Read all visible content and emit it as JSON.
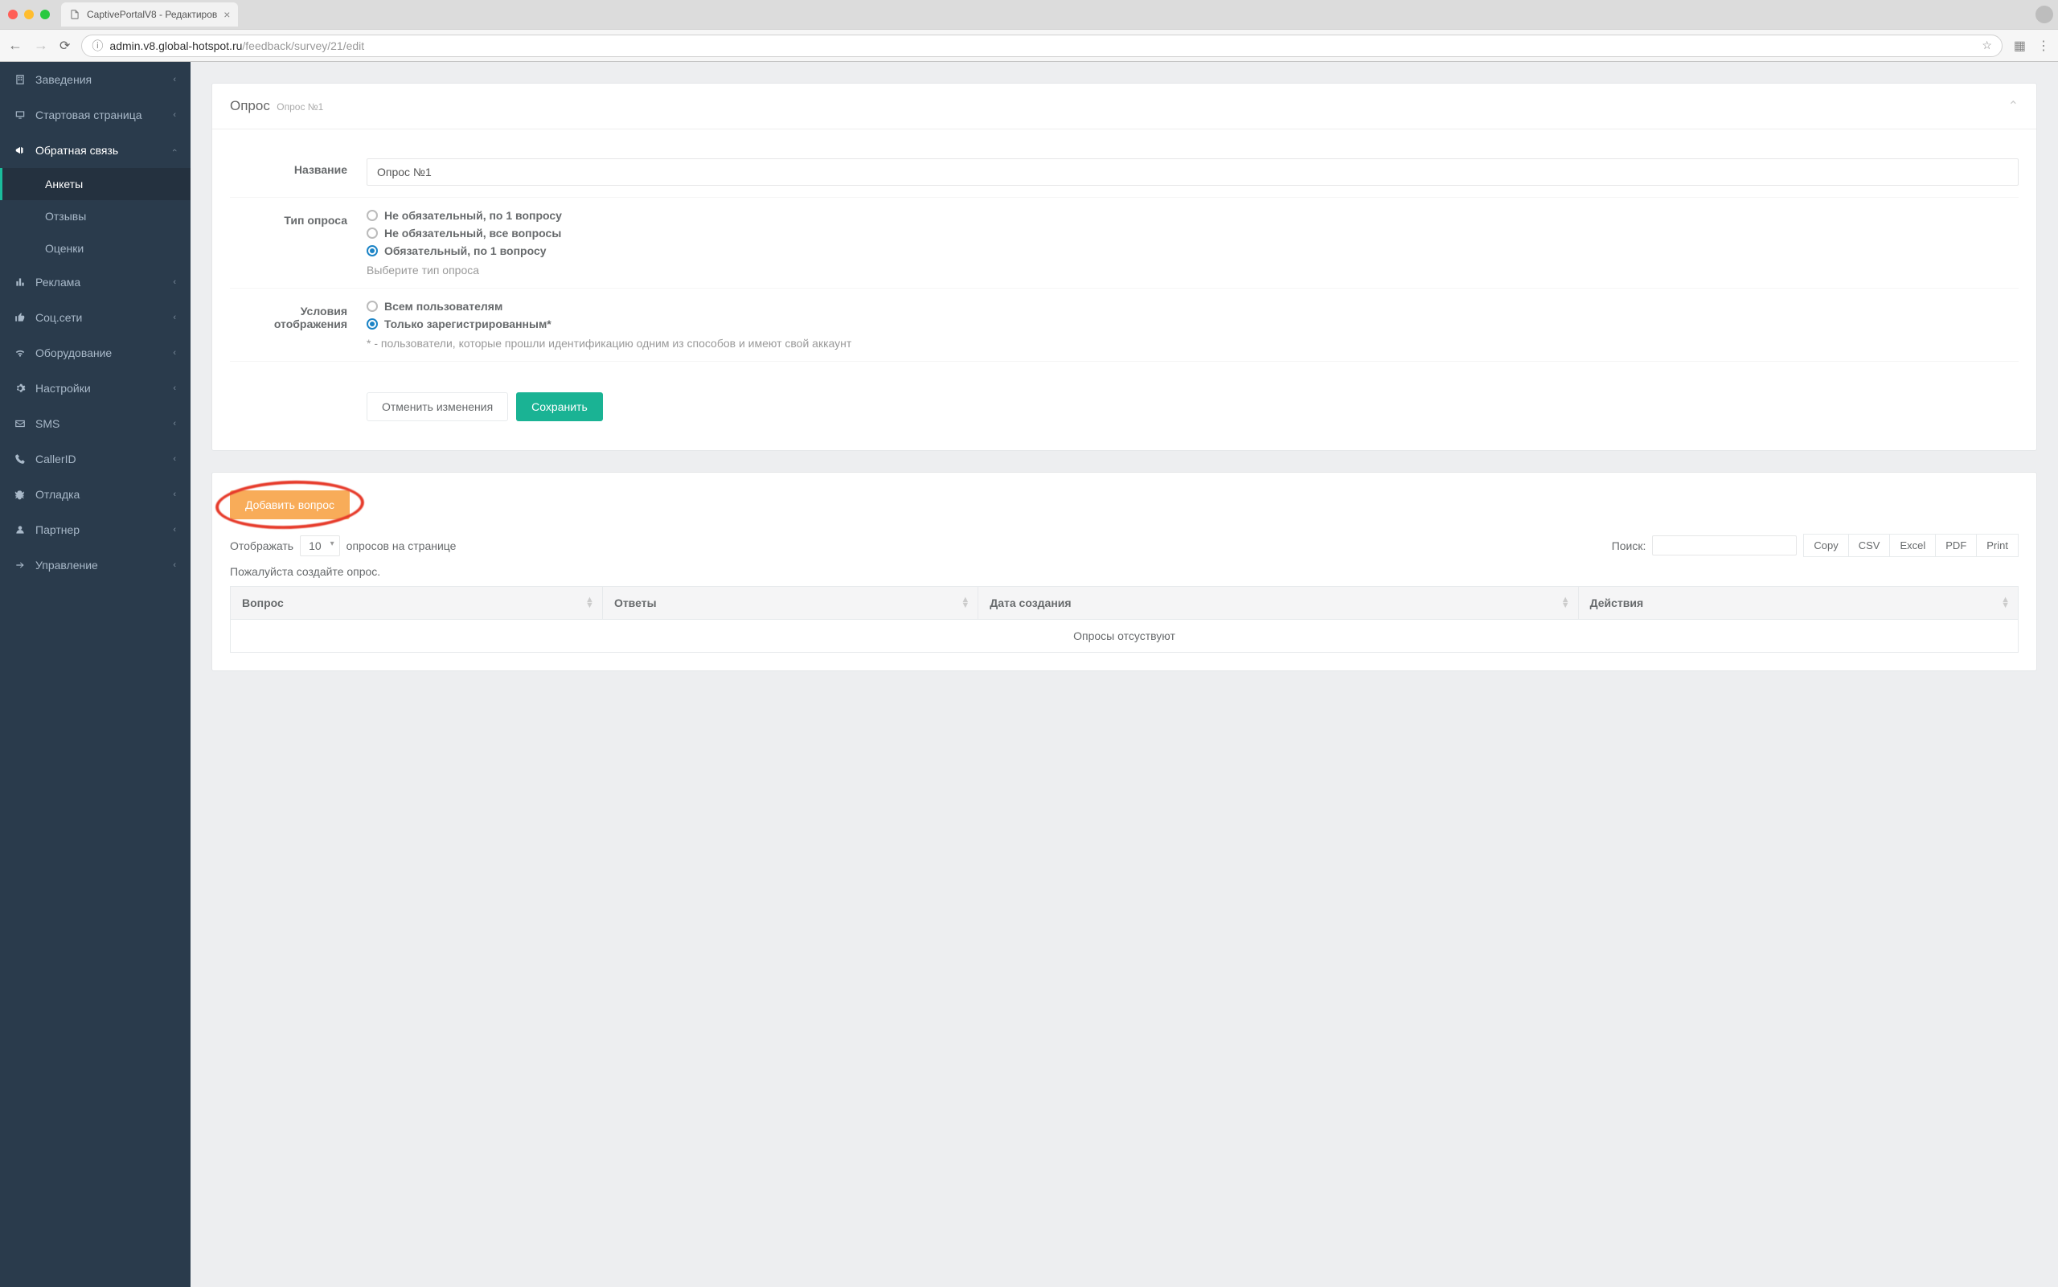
{
  "browser": {
    "tab_title": "CaptivePortalV8 - Редактиров",
    "url_host": "admin.v8.global-hotspot.ru",
    "url_path": "/feedback/survey/21/edit"
  },
  "sidebar": {
    "items": [
      {
        "label": "Заведения",
        "icon": "building"
      },
      {
        "label": "Стартовая страница",
        "icon": "display"
      },
      {
        "label": "Обратная связь",
        "icon": "megaphone",
        "open": true,
        "sub": [
          {
            "label": "Анкеты",
            "active": true
          },
          {
            "label": "Отзывы"
          },
          {
            "label": "Оценки"
          }
        ]
      },
      {
        "label": "Реклама",
        "icon": "chart"
      },
      {
        "label": "Соц.сети",
        "icon": "thumbs-up"
      },
      {
        "label": "Оборудование",
        "icon": "wifi"
      },
      {
        "label": "Настройки",
        "icon": "cogs"
      },
      {
        "label": "SMS",
        "icon": "envelope"
      },
      {
        "label": "CallerID",
        "icon": "phone"
      },
      {
        "label": "Отладка",
        "icon": "bug"
      },
      {
        "label": "Партнер",
        "icon": "user"
      },
      {
        "label": "Управление",
        "icon": "arrow-right"
      }
    ]
  },
  "survey_panel": {
    "title": "Опрос",
    "subtitle": "Опрос №1",
    "fields": {
      "name_label": "Название",
      "name_value": "Опрос №1",
      "type_label": "Тип опроса",
      "type_options": [
        {
          "label": "Не обязательный, по 1 вопросу",
          "checked": false
        },
        {
          "label": "Не обязательный, все вопросы",
          "checked": false
        },
        {
          "label": "Обязательный, по 1 вопросу",
          "checked": true
        }
      ],
      "type_help": "Выберите тип опроса",
      "display_label": "Условия отображения",
      "display_options": [
        {
          "label": "Всем пользователям",
          "checked": false
        },
        {
          "label": "Только зарегистрированным*",
          "checked": true
        }
      ],
      "display_help": "* - пользователи, которые прошли идентификацию одним из способов и имеют свой аккаунт"
    },
    "buttons": {
      "cancel": "Отменить изменения",
      "save": "Сохранить"
    }
  },
  "questions_panel": {
    "add_button": "Добавить вопрос",
    "show_label": "Отображать",
    "page_size": "10",
    "show_suffix": "опросов на странице",
    "search_label": "Поиск:",
    "export": [
      "Copy",
      "CSV",
      "Excel",
      "PDF",
      "Print"
    ],
    "empty_msg": "Пожалуйста создайте опрос.",
    "columns": [
      "Вопрос",
      "Ответы",
      "Дата создания",
      "Действия"
    ],
    "empty_row": "Опросы отсуствуют"
  }
}
